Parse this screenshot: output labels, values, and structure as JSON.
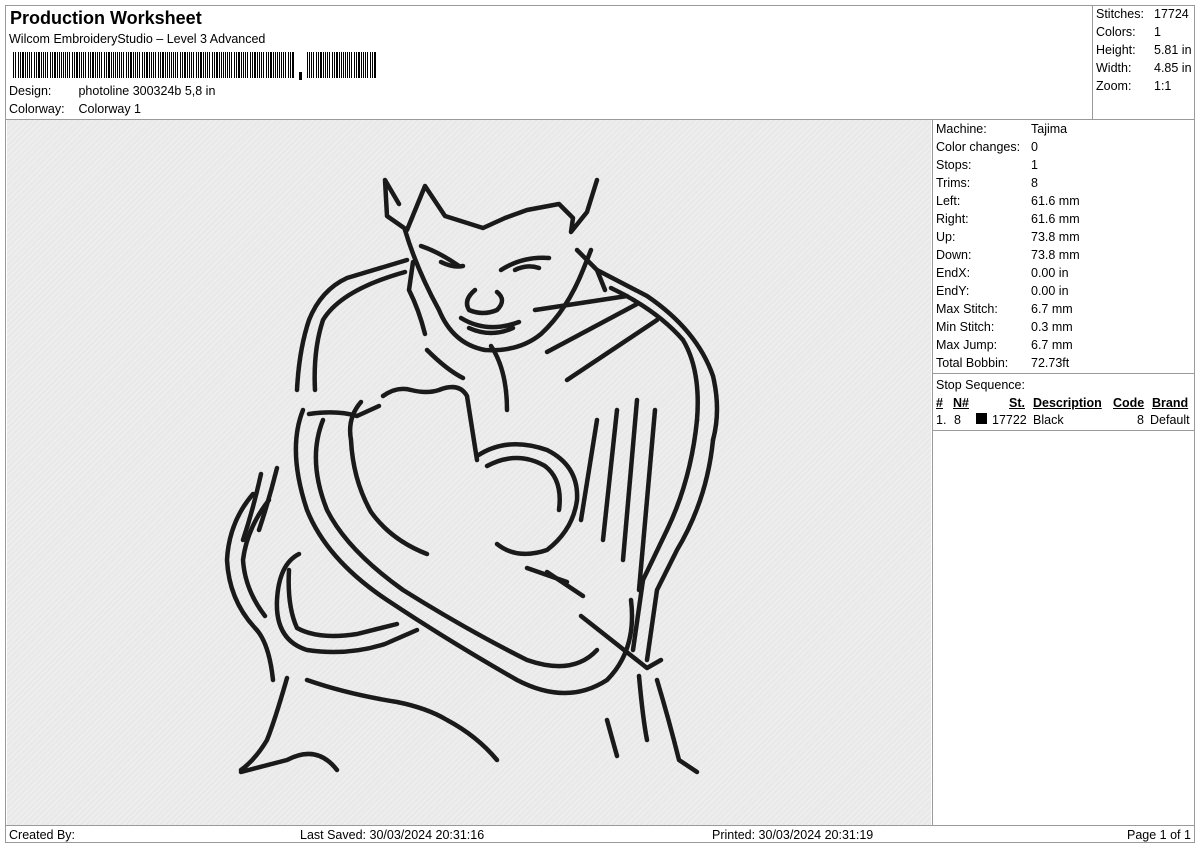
{
  "header": {
    "title": "Production Worksheet",
    "software": "Wilcom EmbroideryStudio – Level 3 Advanced",
    "design_label": "Design:",
    "design_value": "photoline 300324b 5,8 in",
    "colorway_label": "Colorway:",
    "colorway_value": "Colorway 1"
  },
  "summary": {
    "stitches_label": "Stitches:",
    "stitches_value": "17724",
    "colors_label": "Colors:",
    "colors_value": "1",
    "height_label": "Height:",
    "height_value": "5.81 in",
    "width_label": "Width:",
    "width_value": "4.85 in",
    "zoom_label": "Zoom:",
    "zoom_value": "1:1"
  },
  "machine_info": [
    {
      "label": "Machine:",
      "value": "Tajima"
    },
    {
      "label": "Color changes:",
      "value": "0"
    },
    {
      "label": "Stops:",
      "value": "1"
    },
    {
      "label": "Trims:",
      "value": "8"
    },
    {
      "label": "Left:",
      "value": "61.6 mm"
    },
    {
      "label": "Right:",
      "value": "61.6 mm"
    },
    {
      "label": "Up:",
      "value": "73.8 mm"
    },
    {
      "label": "Down:",
      "value": "73.8 mm"
    },
    {
      "label": "EndX:",
      "value": "0.00 in"
    },
    {
      "label": "EndY:",
      "value": "0.00 in"
    },
    {
      "label": "Max Stitch:",
      "value": "6.7 mm"
    },
    {
      "label": "Min Stitch:",
      "value": "0.3 mm"
    },
    {
      "label": "Max Jump:",
      "value": "6.7 mm"
    },
    {
      "label": "Total Bobbin:",
      "value": "72.73ft"
    }
  ],
  "stop_sequence": {
    "title": "Stop Sequence:",
    "headers": {
      "num": "#",
      "n": "N#",
      "st": "St.",
      "description": "Description",
      "code": "Code",
      "brand": "Brand"
    },
    "rows": [
      {
        "num": "1.",
        "n": "8",
        "color": "#000000",
        "st": "17722",
        "description": "Black",
        "code": "8",
        "brand": "Default"
      }
    ]
  },
  "footer": {
    "created_by": "Created By:",
    "last_saved": "Last Saved: 30/03/2024 20:31:16",
    "printed": "Printed: 30/03/2024 20:31:19",
    "page": "Page 1 of 1"
  },
  "colors": {
    "thread": "#1a1a1a",
    "canvas": "#e9e9e9",
    "border": "#9a9a9a"
  }
}
